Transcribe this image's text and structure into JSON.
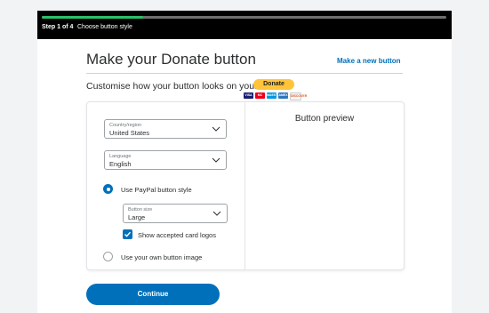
{
  "progress": {
    "step_label": "Step 1 of 4",
    "step_description": "Choose button style",
    "fraction": 0.25
  },
  "header": {
    "title": "Make your Donate button",
    "make_new_link": "Make a new button"
  },
  "subtitle": "Customise how your button looks on your site",
  "form": {
    "country": {
      "label": "Country/region",
      "value": "United States"
    },
    "language": {
      "label": "Language",
      "value": "English"
    },
    "option_paypal_style": {
      "label": "Use PayPal button style",
      "selected": true
    },
    "button_size": {
      "label": "Button size",
      "value": "Large"
    },
    "show_card_logos": {
      "label": "Show accepted card logos",
      "checked": true
    },
    "option_own_image": {
      "label": "Use your own button image",
      "selected": false
    }
  },
  "preview": {
    "title": "Button preview",
    "donate_label": "Donate",
    "card_logos": [
      "VISA",
      "MC",
      "MAESTRO",
      "AMEX",
      "DISCOVER"
    ]
  },
  "footer": {
    "continue_label": "Continue"
  },
  "colors": {
    "accent": "#0070ba",
    "progress": "#2bbf6a",
    "donate": "#ffc439"
  }
}
